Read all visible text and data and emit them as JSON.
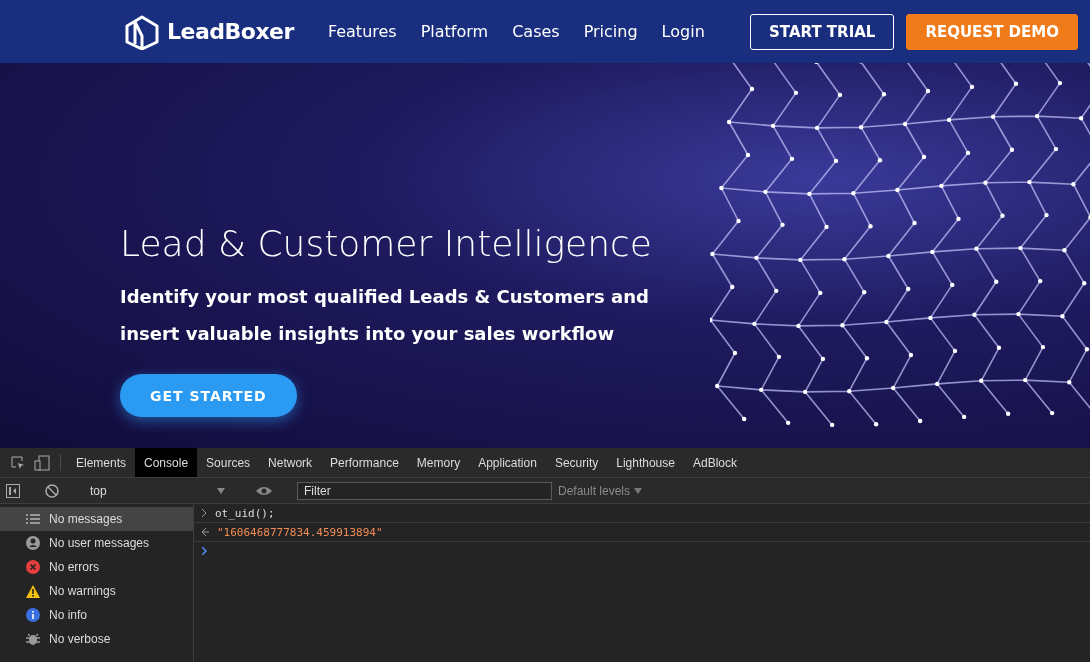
{
  "site": {
    "brand": "LeadBoxer",
    "nav": [
      {
        "label": "Features"
      },
      {
        "label": "Platform"
      },
      {
        "label": "Cases"
      },
      {
        "label": "Pricing"
      },
      {
        "label": "Login"
      }
    ],
    "buttons": [
      {
        "label": "START TRIAL",
        "kind": "outline"
      },
      {
        "label": "REQUEST DEMO",
        "kind": "solid"
      }
    ],
    "hero": {
      "title": "Lead & Customer Intelligence",
      "subtitle": "Identify your most qualified Leads & Customers and insert valuable insights into your sales workflow",
      "cta": "GET STARTED"
    }
  },
  "devtools": {
    "tabs": [
      {
        "label": "Elements",
        "selected": false
      },
      {
        "label": "Console",
        "selected": true
      },
      {
        "label": "Sources",
        "selected": false
      },
      {
        "label": "Network",
        "selected": false
      },
      {
        "label": "Performance",
        "selected": false
      },
      {
        "label": "Memory",
        "selected": false
      },
      {
        "label": "Application",
        "selected": false
      },
      {
        "label": "Security",
        "selected": false
      },
      {
        "label": "Lighthouse",
        "selected": false
      },
      {
        "label": "AdBlock",
        "selected": false
      }
    ],
    "context": "top",
    "filter": {
      "placeholder": "Filter"
    },
    "levels": "Default levels",
    "sidebar": [
      {
        "label": "No messages",
        "kind": "list",
        "selected": true
      },
      {
        "label": "No user messages",
        "kind": "user",
        "selected": false
      },
      {
        "label": "No errors",
        "kind": "error",
        "selected": false
      },
      {
        "label": "No warnings",
        "kind": "warning",
        "selected": false
      },
      {
        "label": "No info",
        "kind": "info",
        "selected": false
      },
      {
        "label": "No verbose",
        "kind": "verbose",
        "selected": false
      }
    ],
    "console": [
      {
        "kind": "input",
        "text": "ot_uid();"
      },
      {
        "kind": "result",
        "text": "\"1606468777834.459913894\""
      },
      {
        "kind": "prompt"
      }
    ]
  }
}
